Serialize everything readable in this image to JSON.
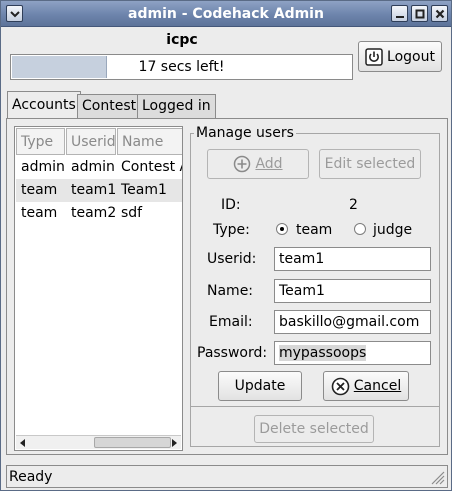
{
  "window": {
    "title": "admin - Codehack Admin"
  },
  "header": {
    "contest_name": "icpc",
    "timer_text": "17 secs left!",
    "timer_progress": 0.28,
    "logout_label": "Logout"
  },
  "tabs": [
    {
      "label": "Accounts",
      "active": true
    },
    {
      "label": "Contest"
    },
    {
      "label": "Logged in"
    }
  ],
  "accounts_list": {
    "columns": [
      "Type",
      "Userid",
      "Name"
    ],
    "rows": [
      {
        "type": "admin",
        "userid": "admin",
        "name": "Contest A"
      },
      {
        "type": "team",
        "userid": "team1",
        "name": "Team1",
        "selected": true
      },
      {
        "type": "team",
        "userid": "team2",
        "name": "sdf"
      }
    ]
  },
  "manage_users": {
    "group_title": "Manage users",
    "add_label": "Add",
    "edit_label": "Edit selected",
    "id_label": "ID:",
    "id_value": "2",
    "type_label": "Type:",
    "type_options": [
      "team",
      "judge"
    ],
    "type_selected": "team",
    "userid_label": "Userid:",
    "userid_value": "team1",
    "name_label": "Name:",
    "name_value": "Team1",
    "email_label": "Email:",
    "email_value": "baskillo@gmail.com",
    "password_label": "Password:",
    "password_value": "mypassoops",
    "update_label": "Update",
    "cancel_label": "Cancel",
    "delete_label": "Delete selected"
  },
  "status_bar": {
    "text": "Ready"
  }
}
